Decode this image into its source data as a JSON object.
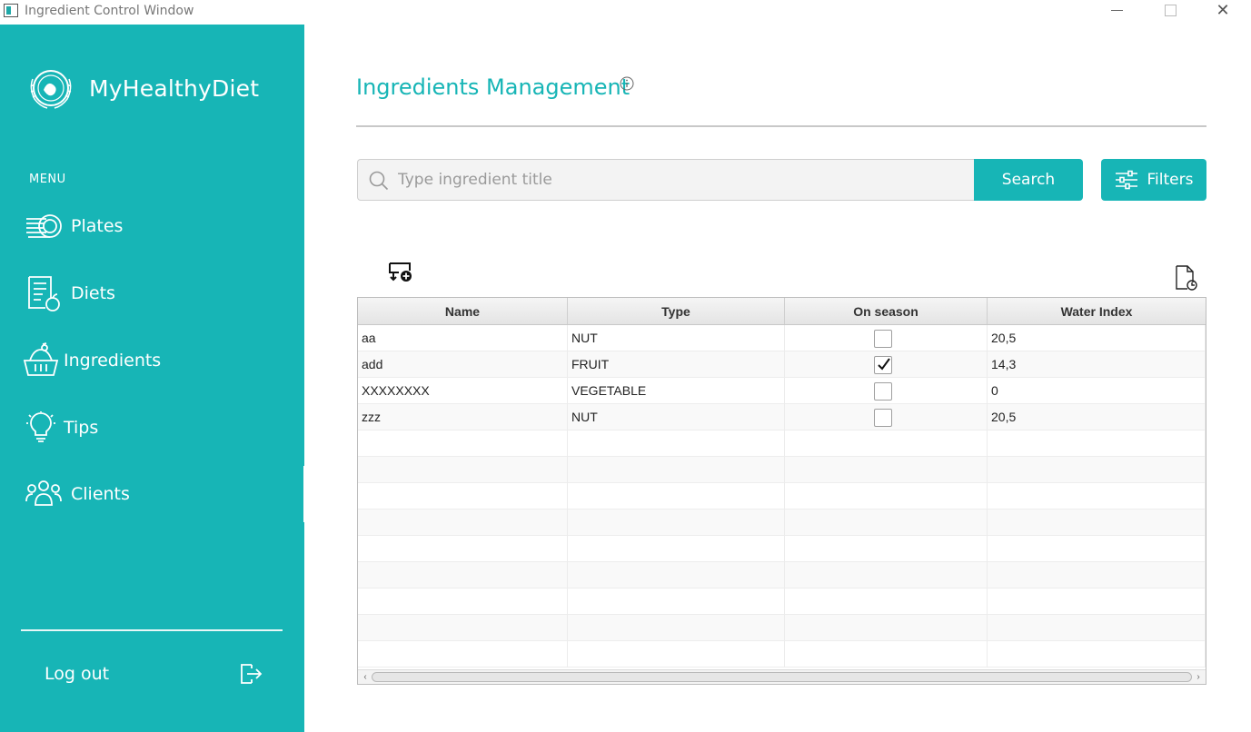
{
  "window": {
    "title": "Ingredient Control Window",
    "close_glyph": "✕"
  },
  "sidebar": {
    "brand": "MyHealthyDiet",
    "menu_label": "MENU",
    "items": [
      {
        "label": "Plates",
        "icon": "plates-icon"
      },
      {
        "label": "Diets",
        "icon": "diet-list-icon"
      },
      {
        "label": "Ingredients",
        "icon": "basket-icon"
      },
      {
        "label": "Tips",
        "icon": "lightbulb-icon"
      },
      {
        "label": "Clients",
        "icon": "clients-icon"
      }
    ],
    "logout_label": "Log out",
    "accent_color": "#17b5b6"
  },
  "main": {
    "title": "Ingredients Management",
    "search": {
      "placeholder": "Type ingredient title",
      "button_label": "Search"
    },
    "filters_label": "Filters"
  },
  "table": {
    "columns": [
      "Name",
      "Type",
      "On season",
      "Water Index"
    ],
    "rows": [
      {
        "name": "aa",
        "type": "NUT",
        "on_season": false,
        "water_index": "20,5"
      },
      {
        "name": "add",
        "type": "FRUIT",
        "on_season": true,
        "water_index": "14,3"
      },
      {
        "name": "XXXXXXXX",
        "type": "VEGETABLE",
        "on_season": false,
        "water_index": "0"
      },
      {
        "name": "zzz",
        "type": "NUT",
        "on_season": false,
        "water_index": "20,5"
      }
    ],
    "scroll_left": "‹",
    "scroll_right": "›"
  }
}
